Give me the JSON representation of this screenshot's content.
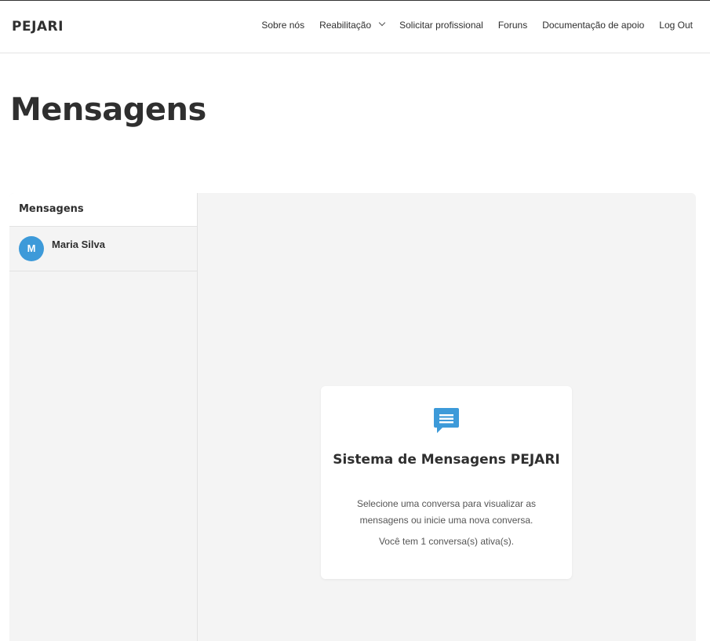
{
  "header": {
    "brand": "PEJARI",
    "nav": [
      {
        "label": "Sobre nós"
      },
      {
        "label": "Reabilitação"
      },
      {
        "label": "Solicitar profissional"
      },
      {
        "label": "Foruns"
      },
      {
        "label": "Documentação de apoio"
      },
      {
        "label": "Log Out"
      }
    ]
  },
  "page": {
    "title": "Mensagens"
  },
  "sidebar": {
    "title": "Mensagens",
    "conversations": [
      {
        "initial": "M",
        "name": "Maria Silva"
      }
    ]
  },
  "empty_state": {
    "icon": "chat-bubble-icon",
    "title": "Sistema de Mensagens PEJARI",
    "description": "Selecione uma conversa para visualizar as mensagens ou inicie uma nova conversa.",
    "status": "Você tem 1 conversa(s) ativa(s)."
  },
  "colors": {
    "accent": "#3d9ad9",
    "panel_bg": "#f4f4f4",
    "text": "#2f2f2f"
  }
}
